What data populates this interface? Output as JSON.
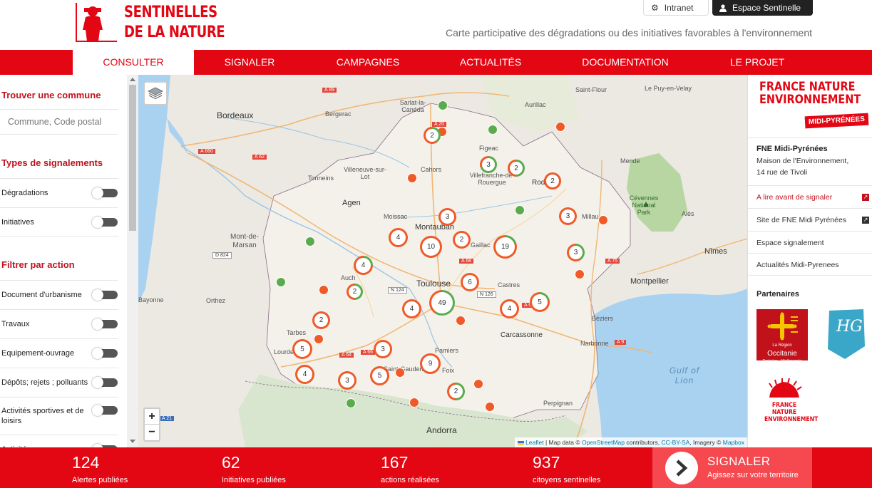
{
  "header": {
    "logo_line1": "SENTINELLES",
    "logo_line2": "DE LA NATURE",
    "tagline": "Carte participative des dégradations ou des initiatives favorables à l'environnement",
    "intranet_label": "Intranet",
    "espace_label": "Espace Sentinelle"
  },
  "nav": {
    "items": [
      "CONSULTER",
      "SIGNALER",
      "CAMPAGNES",
      "ACTUALITÉS",
      "DOCUMENTATION",
      "LE PROJET"
    ],
    "active": "CONSULTER"
  },
  "sidebar": {
    "find_heading": "Trouver une commune",
    "search_placeholder": "Commune, Code postal",
    "types_heading": "Types de signalements",
    "types": [
      "Dégradations",
      "Initiatives"
    ],
    "filter_heading": "Filtrer par action",
    "actions": [
      "Document d'urbanisme",
      "Travaux",
      "Equipement-ouvrage",
      "Dépôts; rejets ; polluants",
      "Activités sportives et de loisirs",
      "Activités"
    ]
  },
  "map": {
    "places": [
      "Bordeaux",
      "Bergerac",
      "Sarlat-la-Canéda",
      "Aurillac",
      "Saint-Flour",
      "Le Puy-en-Velay",
      "Figeac",
      "Cahors",
      "Villeneuve-sur-Lot",
      "Tonneins",
      "Villefranche-de-Rouergue",
      "Rodez",
      "Mende",
      "Agen",
      "Mont-de-Marsan",
      "Moissac",
      "Montauban",
      "Gaillac",
      "Millau",
      "Alès",
      "Nîmes",
      "Auch",
      "Toulouse",
      "Castres",
      "Montpellier",
      "Orthez",
      "Tarbes",
      "Lourdes",
      "Saint-Gaudens",
      "Pamiers",
      "Foix",
      "Carcassonne",
      "Béziers",
      "Narbonne",
      "Perpignan",
      "Andorra",
      "Cévennes National Park",
      "Bayonne"
    ],
    "sea_label": "Gulf of Lion",
    "road_labels": [
      "A 89",
      "A 20",
      "A 62",
      "A 660",
      "A 75",
      "N 124",
      "A 64",
      "A 68",
      "N 126",
      "A 61",
      "A 9",
      "A 66",
      "D 824",
      "A 21"
    ],
    "clusters": [
      {
        "count": "2"
      },
      {
        "count": "3"
      },
      {
        "count": "2"
      },
      {
        "count": "2"
      },
      {
        "count": "3"
      },
      {
        "count": "4"
      },
      {
        "count": "3"
      },
      {
        "count": "10"
      },
      {
        "count": "2"
      },
      {
        "count": "19"
      },
      {
        "count": "3"
      },
      {
        "count": "4"
      },
      {
        "count": "2"
      },
      {
        "count": "6"
      },
      {
        "count": "49"
      },
      {
        "count": "4"
      },
      {
        "count": "4"
      },
      {
        "count": "5"
      },
      {
        "count": "2"
      },
      {
        "count": "5"
      },
      {
        "count": "3"
      },
      {
        "count": "9"
      },
      {
        "count": "4"
      },
      {
        "count": "3"
      },
      {
        "count": "5"
      },
      {
        "count": "2"
      }
    ],
    "zoom_in": "+",
    "zoom_out": "−",
    "attribution": {
      "leaflet": "Leaflet",
      "map_data": " | Map data © ",
      "osm": "OpenStreetMap",
      "contrib": " contributors, ",
      "cc": "CC-BY-SA",
      "imagery": ", Imagery © ",
      "mapbox": "Mapbox"
    }
  },
  "right_panel": {
    "logo_line1": "FRANCE NATURE",
    "logo_line2": "ENVIRONNEMENT",
    "logo_sub": "MIDI-PYRÉNÉES",
    "org_name": "FNE Midi-Pyrénées",
    "address_line1": "Maison de l'Environnement,",
    "address_line2": "14 rue de Tivoli",
    "links": [
      "A lire avant de signaler",
      "Site de FNE Midi Pyrénées",
      "Espace signalement",
      "Actualités Midi-Pyrenees"
    ],
    "partners_heading": "Partenaires",
    "occitanie_line1": "La Région",
    "occitanie_line2": "Occitanie",
    "occitanie_line3": "Pyrénées · Méditerranée",
    "hg_label": "HG",
    "fne_line1": "FRANCE NATURE",
    "fne_line2": "ENVIRONNEMENT"
  },
  "footer": {
    "stats": [
      {
        "value": "124",
        "label": "Alertes publiées"
      },
      {
        "value": "62",
        "label": "Initiatives publiées"
      },
      {
        "value": "167",
        "label": "actions réalisées"
      },
      {
        "value": "937",
        "label": "citoyens sentinelles"
      }
    ],
    "cta_title": "SIGNALER",
    "cta_sub": "Agissez sur votre territoire"
  },
  "colors": {
    "brand_red": "#e30613",
    "cta_red": "#f5484f",
    "marker_red": "#f05a28",
    "marker_green": "#5aab4d",
    "sea": "#a9d1f0"
  }
}
